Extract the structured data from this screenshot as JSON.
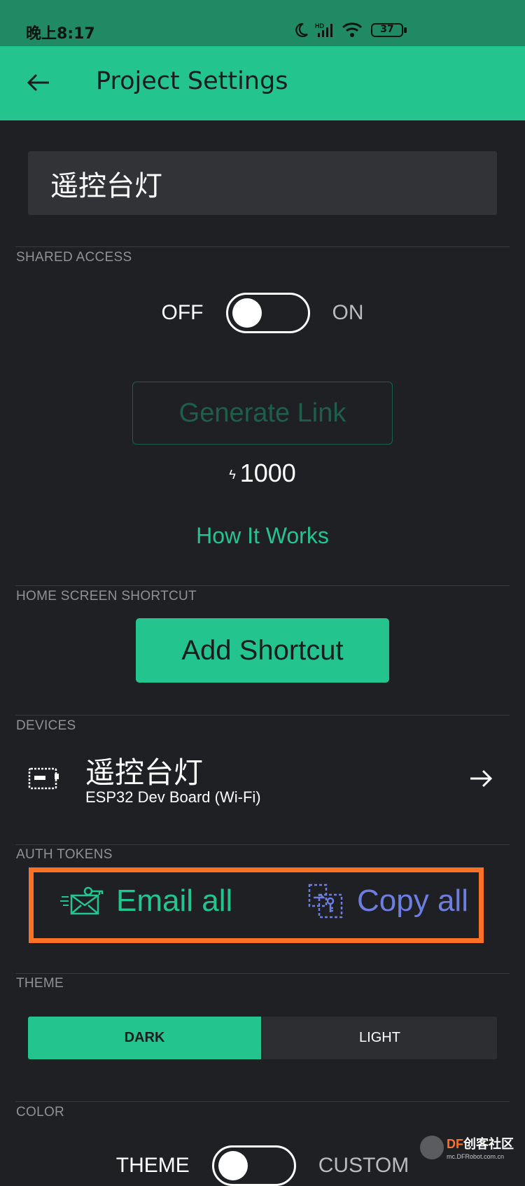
{
  "status_bar": {
    "time": "晚上8:17",
    "battery": "37",
    "hd_label": "HD"
  },
  "header": {
    "title": "Project Settings"
  },
  "project_name": "遥控台灯",
  "shared_access": {
    "section_label": "SHARED ACCESS",
    "off_label": "OFF",
    "on_label": "ON",
    "enabled": false,
    "generate_link_label": "Generate Link",
    "energy_cost": "1000",
    "how_it_works_label": "How It Works"
  },
  "home_screen_shortcut": {
    "section_label": "HOME SCREEN SHORTCUT",
    "button_label": "Add Shortcut"
  },
  "devices": {
    "section_label": "DEVICES",
    "items": [
      {
        "name": "遥控台灯",
        "board": "ESP32 Dev Board (Wi-Fi)",
        "icon": "device-board-icon"
      }
    ]
  },
  "auth_tokens": {
    "section_label": "AUTH TOKENS",
    "email_all_label": "Email all",
    "copy_all_label": "Copy all",
    "highlight_color": "#fb7226"
  },
  "theme": {
    "section_label": "THEME",
    "options": [
      "DARK",
      "LIGHT"
    ],
    "selected": "DARK"
  },
  "color": {
    "section_label": "COLOR",
    "left_label": "THEME",
    "right_label": "CUSTOM"
  },
  "watermark": {
    "brand": "DF",
    "brand_cn": "创客社区",
    "url": "mc.DFRobot.com.cn"
  },
  "colors": {
    "accent": "#23c48e",
    "background": "#1f2024",
    "status_bar": "#1f8a64",
    "copy_accent": "#6d7ee0"
  }
}
